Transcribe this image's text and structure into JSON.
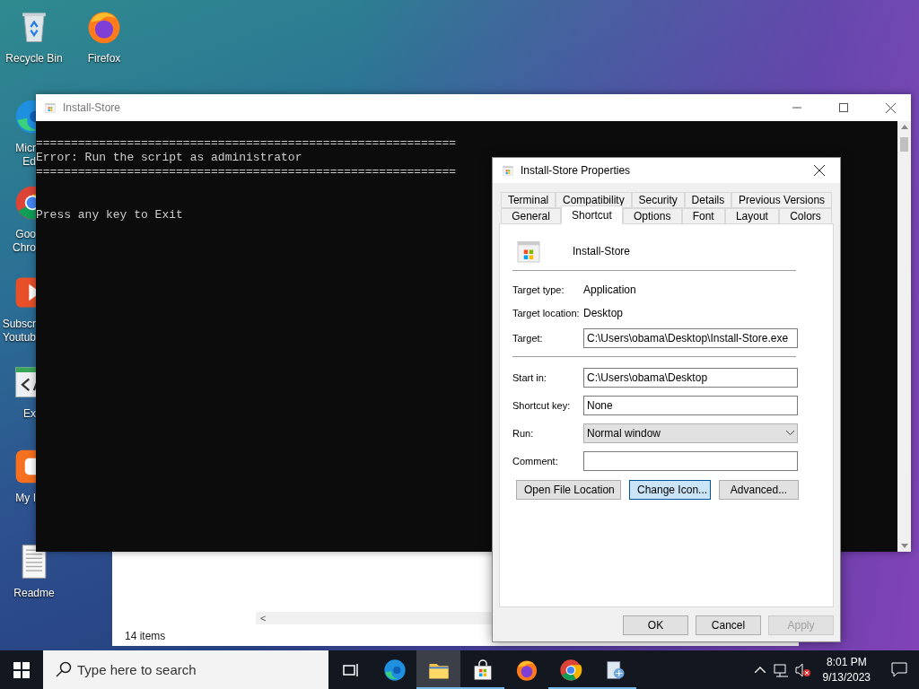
{
  "desktop_icons": [
    {
      "kind": "recycle",
      "label": "Recycle Bin"
    },
    {
      "kind": "firefox",
      "label": "Firefox"
    },
    {
      "kind": "readme",
      "label": "Readme"
    }
  ],
  "covered_icons": [
    {
      "kind": "edge",
      "lines": [
        "Micr",
        "Ed"
      ]
    },
    {
      "kind": "chrome",
      "lines": [
        "Goo",
        "Chro"
      ]
    },
    {
      "kind": "subscribe",
      "lines": [
        "Subscr",
        "Youtub"
      ]
    },
    {
      "kind": "code",
      "lines": [
        "Ex"
      ]
    },
    {
      "kind": "blogger",
      "lines": [
        "My I"
      ]
    }
  ],
  "explorer": {
    "status": "14 items",
    "scroll_arrow": "<"
  },
  "console": {
    "title": "Install-Store",
    "blocks": [
      [
        "============================================================",
        "Error: Run the script as administrator",
        "============================================================"
      ],
      [
        "Press any key to Exit"
      ]
    ]
  },
  "dialog": {
    "title": "Install-Store Properties",
    "tab_rows": [
      [
        {
          "label": "Terminal",
          "selected": false
        },
        {
          "label": "Compatibility",
          "selected": false
        },
        {
          "label": "Security",
          "selected": false
        },
        {
          "label": "Details",
          "selected": false
        },
        {
          "label": "Previous Versions",
          "selected": false
        }
      ],
      [
        {
          "label": "General",
          "selected": false
        },
        {
          "label": "Shortcut",
          "selected": true
        },
        {
          "label": "Options",
          "selected": false
        },
        {
          "label": "Font",
          "selected": false
        },
        {
          "label": "Layout",
          "selected": false
        },
        {
          "label": "Colors",
          "selected": false
        }
      ]
    ],
    "app_name": "Install-Store",
    "info": [
      {
        "label": "Target type:",
        "value": "Application"
      },
      {
        "label": "Target location:",
        "value": "Desktop"
      }
    ],
    "target": {
      "label": "Target:",
      "value": "C:\\Users\\obama\\Desktop\\Install-Store.exe"
    },
    "fields": [
      {
        "kind": "text",
        "label": "Start in:",
        "value": "C:\\Users\\obama\\Desktop"
      },
      {
        "kind": "text",
        "label": "Shortcut key:",
        "value": "None"
      },
      {
        "kind": "select",
        "label": "Run:",
        "value": "Normal window"
      },
      {
        "kind": "text",
        "label": "Comment:"
      }
    ],
    "actions": [
      {
        "label": "Open File Location",
        "focused": false
      },
      {
        "label": "Change Icon...",
        "focused": true
      },
      {
        "label": "Advanced...",
        "focused": false
      }
    ],
    "footer": [
      {
        "label": "OK",
        "disabled": false
      },
      {
        "label": "Cancel",
        "disabled": false
      },
      {
        "label": "Apply",
        "disabled": true
      }
    ]
  },
  "taskbar": {
    "search": {
      "placeholder": "Type here to search"
    },
    "apps": [
      {
        "kind": "edge",
        "open": false,
        "active": false
      },
      {
        "kind": "explorer",
        "open": true,
        "active": true
      },
      {
        "kind": "store",
        "open": true,
        "active": false
      },
      {
        "kind": "firefox",
        "open": false,
        "active": false
      },
      {
        "kind": "chrome",
        "open": true,
        "active": false
      },
      {
        "kind": "tool",
        "open": true,
        "active": false
      }
    ],
    "time": "8:01 PM",
    "date": "9/13/2023"
  }
}
